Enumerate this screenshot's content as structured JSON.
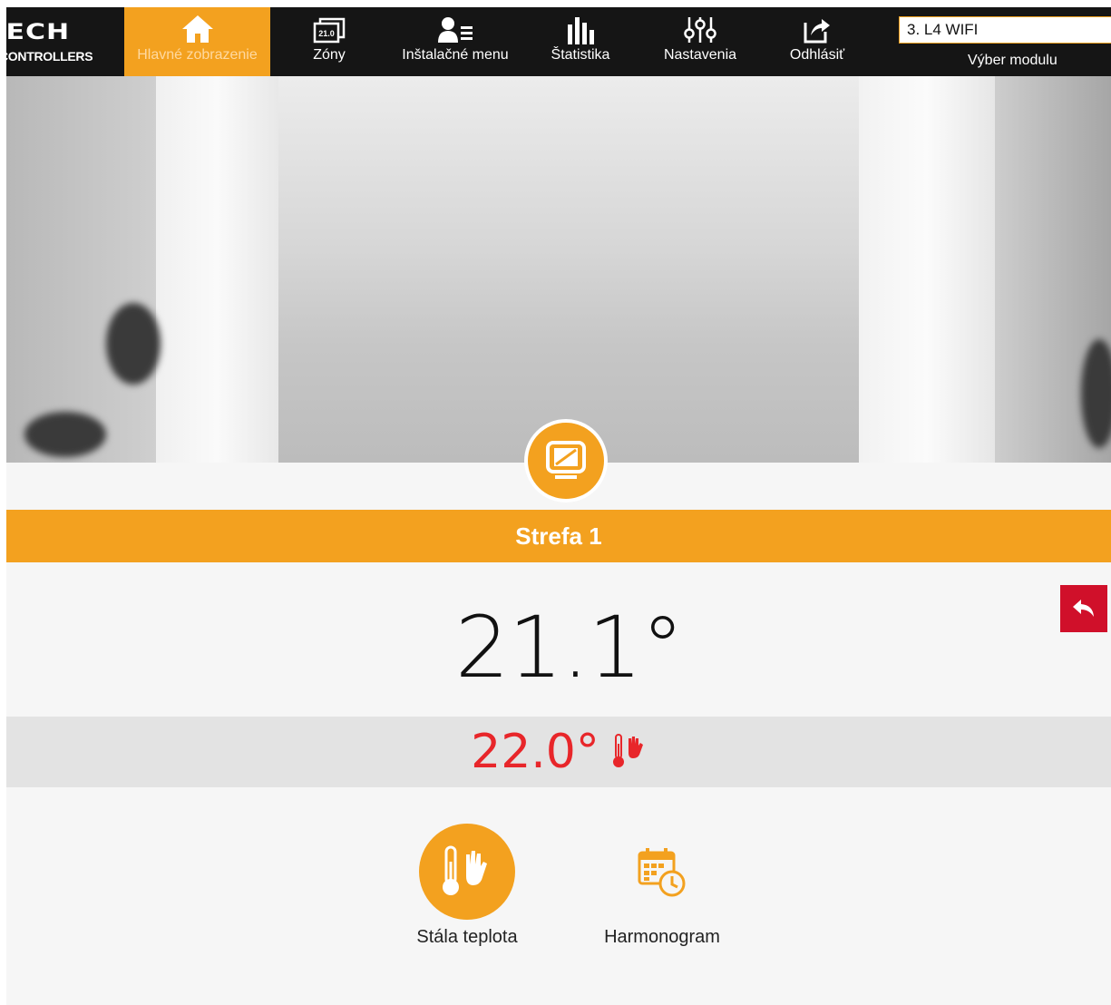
{
  "header": {
    "logo_mark": "TECH",
    "logo_sub": "CONTROLLERS",
    "nav": [
      {
        "label": "Hlavné zobrazenie",
        "icon": "home-icon",
        "active": true
      },
      {
        "label": "Zóny",
        "icon": "zones-icon",
        "badge": "21.0"
      },
      {
        "label": "Inštalačné menu",
        "icon": "installer-menu-icon"
      },
      {
        "label": "Štatistika",
        "icon": "statistics-icon"
      },
      {
        "label": "Nastavenia",
        "icon": "settings-sliders-icon"
      },
      {
        "label": "Odhlásiť",
        "icon": "logout-icon"
      }
    ],
    "module_select": {
      "value": "3. L4 WIFI",
      "label": "Výber modulu"
    }
  },
  "zone": {
    "title": "Strefa 1",
    "current_temp": "21.1°",
    "set_temp": "22.0°",
    "icon": "display-panel-icon"
  },
  "modes": [
    {
      "label": "Stála teplota",
      "icon": "thermometer-hand-icon",
      "active": true
    },
    {
      "label": "Harmonogram",
      "icon": "calendar-clock-icon",
      "active": false
    }
  ],
  "colors": {
    "accent": "#f3a11f",
    "alert": "#e8262a",
    "back": "#d0102a",
    "nav_bg": "#151515"
  }
}
